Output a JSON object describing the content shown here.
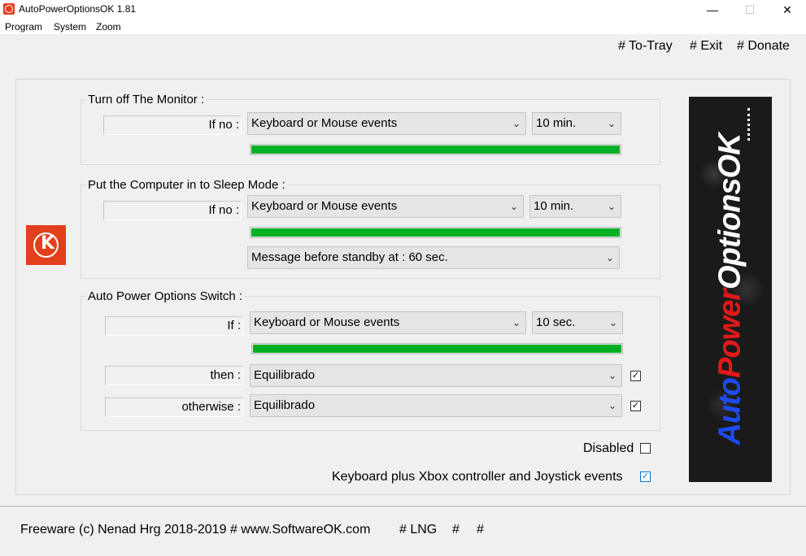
{
  "window": {
    "title": "AutoPowerOptionsOK 1.81",
    "min_glyph": "—",
    "max_glyph": "☐",
    "close_glyph": "✕"
  },
  "menu": [
    "Program",
    "System",
    "Zoom"
  ],
  "top_links": [
    "# To-Tray",
    "# Exit",
    "# Donate"
  ],
  "monitor_group": {
    "label": "Turn off The Monitor :",
    "condition_label": "If no :",
    "event_select": "Keyboard or Mouse events",
    "time_select": "10 min.",
    "progress": 1.0
  },
  "sleep_group": {
    "label": "Put the Computer in to Sleep Mode :",
    "condition_label": "If no :",
    "event_select": "Keyboard or Mouse events",
    "time_select": "10 min.",
    "progress": 1.0,
    "message_select": "Message before standby at : 60 sec."
  },
  "switch_group": {
    "label": "Auto Power Options Switch :",
    "if_label": "If :",
    "event_select": "Keyboard or Mouse events",
    "time_select": "10 sec.",
    "progress": 1.0,
    "then_label": "then :",
    "then_select": "Equilibrado",
    "then_checked": true,
    "otherwise_label": "otherwise :",
    "otherwise_select": "Equilibrado",
    "otherwise_checked": true
  },
  "options": {
    "disabled_label": "Disabled",
    "disabled_checked": false,
    "xbox_label": "Keyboard plus Xbox controller and Joystick events",
    "xbox_checked": true
  },
  "banner": {
    "part1": "Auto",
    "part2": "Power",
    "part3": "OptionsOK"
  },
  "status_bar": {
    "copyright": "Freeware (c) Nenad Hrg 2018-2019 # www.SoftwareOK.com",
    "lng": "# LNG",
    "hash1": "#",
    "hash2": "#"
  },
  "icons": {
    "chevron": "⌄",
    "check": "✓"
  },
  "colors": {
    "accent_orange": "#e2401c",
    "progress_green": "#06b025",
    "banner_blue": "#1e4bf0",
    "banner_red": "#e01a1a"
  }
}
